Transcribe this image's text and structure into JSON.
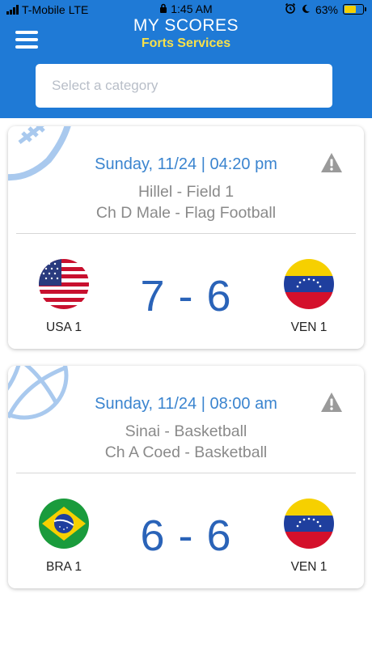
{
  "status_bar": {
    "carrier": "T-Mobile",
    "network": "LTE",
    "time": "1:45 AM",
    "battery": "63%",
    "battery_level": 0.63
  },
  "header": {
    "title": "MY SCORES",
    "subtitle": "Forts Services",
    "search_placeholder": "Select a category"
  },
  "colors": {
    "header_bg": "#1f7ad6",
    "subtitle": "#f7e04a",
    "date": "#3a84cf",
    "score": "#2a63b8"
  },
  "games": [
    {
      "sport_icon": "football-icon",
      "date": "Sunday, 11/24 | 04:20 pm",
      "venue": "Hillel - Field 1",
      "division": "Ch D Male - Flag Football",
      "score": "7 - 6",
      "home": {
        "name": "USA 1",
        "flag": "usa-flag-icon"
      },
      "away": {
        "name": "VEN 1",
        "flag": "venezuela-flag-icon"
      }
    },
    {
      "sport_icon": "basketball-icon",
      "date": "Sunday, 11/24 | 08:00 am",
      "venue": "Sinai - Basketball",
      "division": "Ch A Coed - Basketball",
      "score": "6 - 6",
      "home": {
        "name": "BRA 1",
        "flag": "brazil-flag-icon"
      },
      "away": {
        "name": "VEN 1",
        "flag": "venezuela-flag-icon"
      }
    }
  ]
}
